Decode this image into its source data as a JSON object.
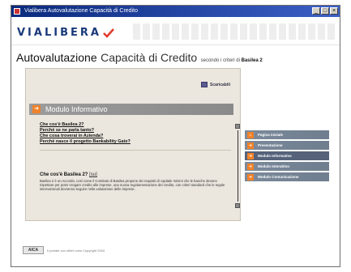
{
  "window": {
    "title": "Vialibera Autovalutazione Capacità di Credito",
    "controls": [
      "_",
      "□",
      "×"
    ]
  },
  "brand": {
    "logo_text": "VIALIBERA"
  },
  "heading": {
    "main": "Autovalutazione",
    "secondary": "Capacità di Credito",
    "subtitle": "secondo i criteri di",
    "subtitle_bold": "Basilea 2"
  },
  "content": {
    "downloads_label": "Scaricabili",
    "module_title": "Modulo Informativo",
    "links": [
      "Che cos'è Basilea 2?",
      "Perché se ne parla tanto?",
      "Che cosa troverai in Azienda?",
      "Perché nasce il progetto Bankability Gate?"
    ],
    "section_title": "Che cos'è Basilea 2?",
    "top_link": "[su]",
    "body_text": "Basilea 2 è un Accordo, così come il Comitato di Basilea propone dei requisiti di capitale minimi che le banche devono rispettare per poter erogare credito alle imprese, una nuova regolamentazione del credito, con criteri standard che le regole internazionali dovranno seguire nella valutazione delle imprese."
  },
  "nav": [
    {
      "label": "Pagina iniziale",
      "icon": "home-icon",
      "glyph": "⌂"
    },
    {
      "label": "Presentazione",
      "icon": "arrow-icon",
      "glyph": "➜"
    },
    {
      "label": "Modulo Informativo",
      "icon": "arrow-icon",
      "glyph": "➜",
      "active": true
    },
    {
      "label": "Modulo Interattivo",
      "icon": "arrow-icon",
      "glyph": "➜"
    },
    {
      "label": "Modulo Comunicazione",
      "icon": "arrow-icon",
      "glyph": "➜"
    }
  ],
  "footer": {
    "badge": "AICA",
    "text": "Il portale con ultimi corsi Copyright 2004"
  },
  "colors": {
    "accent_orange": "#f0822a",
    "title_blue": "#0a2a7d",
    "nav_gray_blue": "#6f7e8f"
  }
}
